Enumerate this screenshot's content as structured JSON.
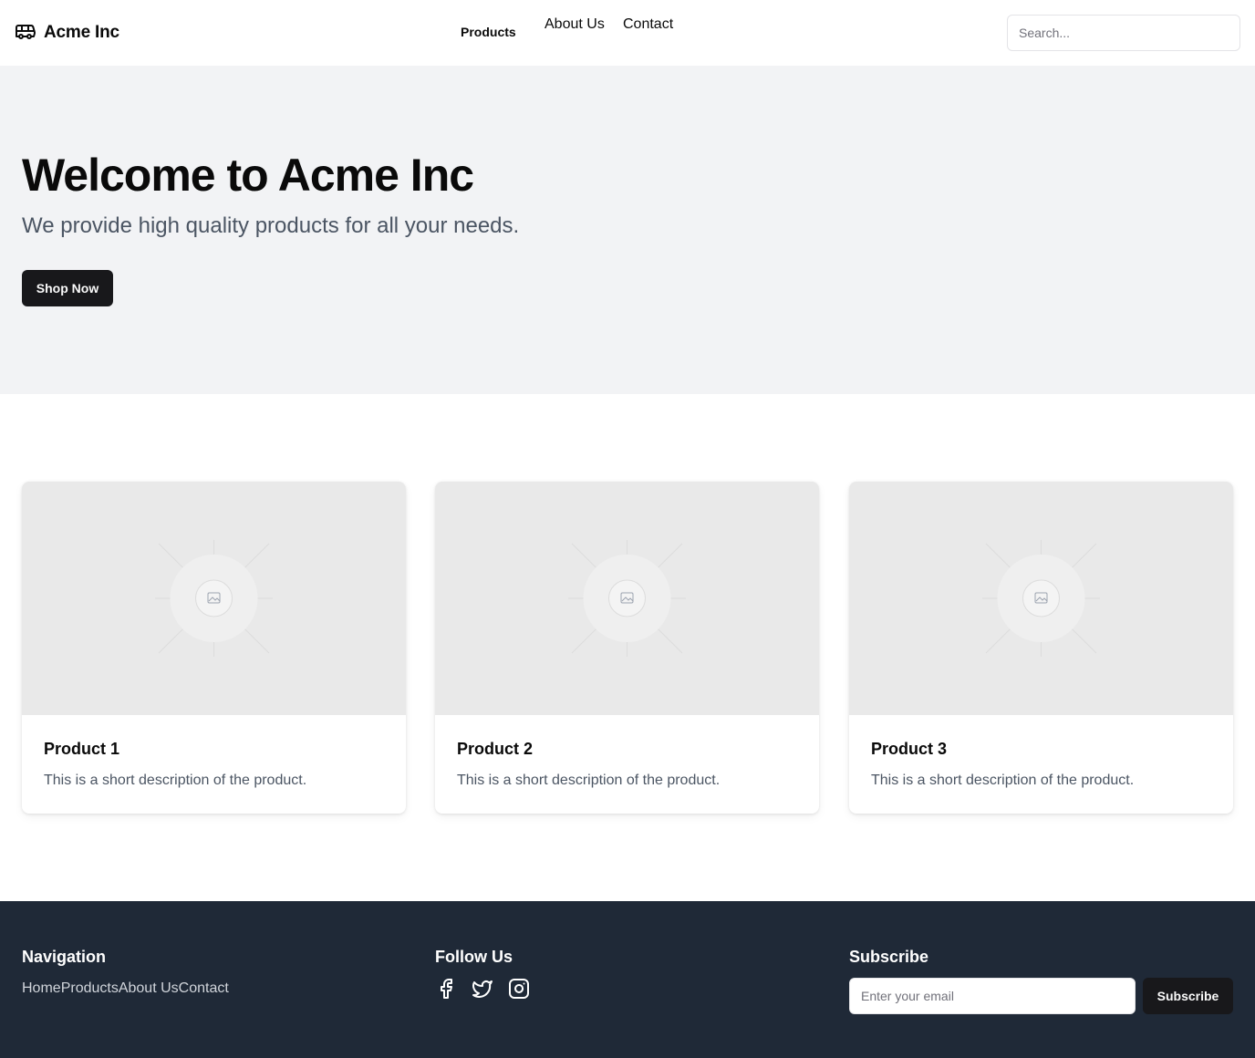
{
  "header": {
    "brand": "Acme Inc",
    "brand_icon": "bus-icon",
    "nav": [
      {
        "label": "Products"
      },
      {
        "label": "About Us"
      },
      {
        "label": "Contact"
      }
    ],
    "search_placeholder": "Search..."
  },
  "hero": {
    "title": "Welcome to Acme Inc",
    "subtitle": "We provide high quality products for all your needs.",
    "cta": "Shop Now"
  },
  "products": [
    {
      "title": "Product 1",
      "description": "This is a short description of the product.",
      "image_icon": "image-placeholder-icon"
    },
    {
      "title": "Product 2",
      "description": "This is a short description of the product.",
      "image_icon": "image-placeholder-icon"
    },
    {
      "title": "Product 3",
      "description": "This is a short description of the product.",
      "image_icon": "image-placeholder-icon"
    }
  ],
  "footer": {
    "navigation": {
      "heading": "Navigation",
      "links": [
        "Home",
        "Products",
        "About Us",
        "Contact"
      ]
    },
    "follow": {
      "heading": "Follow Us",
      "icons": [
        "facebook-icon",
        "twitter-icon",
        "instagram-icon"
      ]
    },
    "subscribe": {
      "heading": "Subscribe",
      "email_placeholder": "Enter your email",
      "button": "Subscribe"
    }
  },
  "colors": {
    "primary_button": "#18181b",
    "hero_bg": "#f2f3f5",
    "footer_bg": "#1f2937",
    "muted_text": "#4b5563"
  }
}
